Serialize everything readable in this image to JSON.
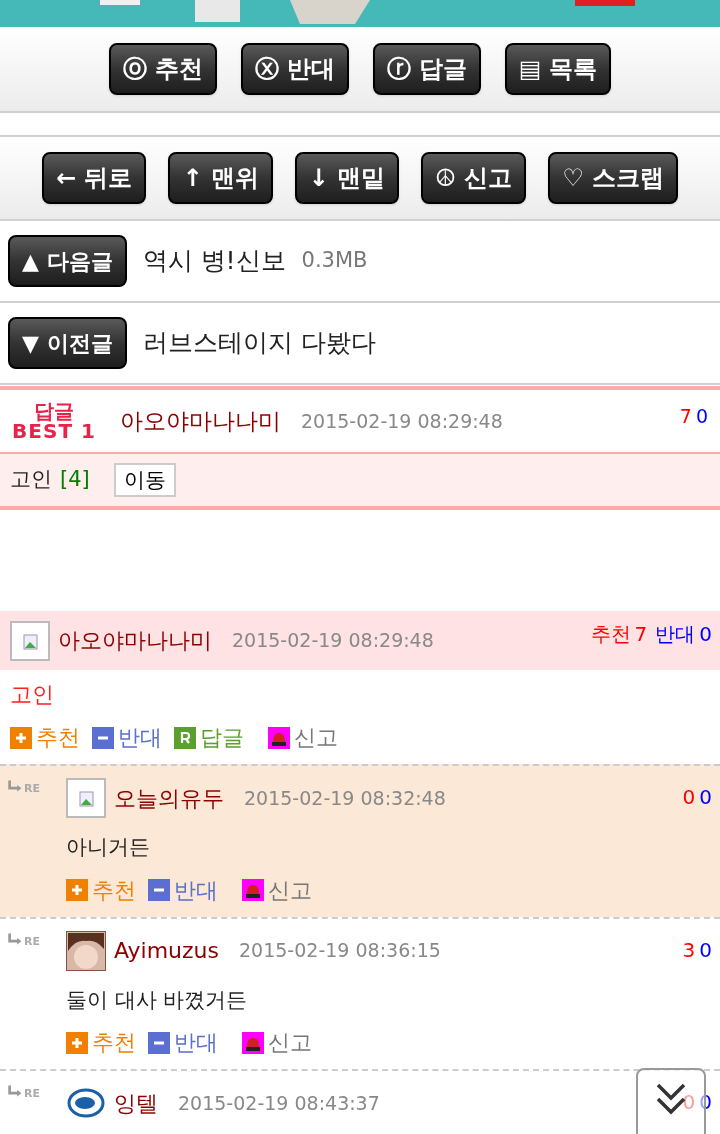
{
  "banner": {
    "kind": "picture"
  },
  "toolbar_top": [
    {
      "icon": "ⓞ",
      "label": "추천"
    },
    {
      "icon": "ⓧ",
      "label": "반대"
    },
    {
      "icon": "ⓡ",
      "label": "답글"
    },
    {
      "icon": "▤",
      "label": "목록"
    }
  ],
  "toolbar_nav": [
    {
      "icon": "←",
      "label": "뒤로"
    },
    {
      "icon": "↑",
      "label": "맨위"
    },
    {
      "icon": "↓",
      "label": "맨밑"
    },
    {
      "icon": "☮",
      "label": "신고"
    },
    {
      "icon": "♡",
      "label": "스크랩"
    }
  ],
  "adjacent_posts": [
    {
      "button": "▲ 다음글",
      "title": "역시 병!신보",
      "size": "0.3MB"
    },
    {
      "button": "▼ 이전글",
      "title": "러브스테이지 다봤다"
    }
  ],
  "best_reply": {
    "badge_top": "답글",
    "badge_bottom": "BEST 1",
    "author": "아오야마나나미",
    "date": "2015-02-19 08:29:48",
    "up": "7",
    "down": "0",
    "body": "고인",
    "count": "[4]",
    "move_button": "이동"
  },
  "comments": [
    {
      "kind": "comment",
      "avatar": {
        "kind": "broken"
      },
      "author": "아오야마나나미",
      "date": "2015-02-19 08:29:48",
      "up_label": "추천",
      "up": "7",
      "down_label": "반대",
      "down": "0",
      "body": "고인",
      "actions": [
        {
          "kind": "up",
          "label": "추천"
        },
        {
          "kind": "down",
          "label": "반대"
        },
        {
          "kind": "reply",
          "label": "답글"
        },
        {
          "kind": "report",
          "label": "신고"
        }
      ]
    },
    {
      "kind": "reply",
      "re_label": "RE",
      "avatar": {
        "kind": "broken"
      },
      "highlighted": true,
      "author": "오늘의유두",
      "date": "2015-02-19 08:32:48",
      "up": "0",
      "down": "0",
      "body": "아니거든",
      "actions": [
        {
          "kind": "up",
          "label": "추천"
        },
        {
          "kind": "down",
          "label": "반대"
        },
        {
          "kind": "report",
          "label": "신고"
        }
      ]
    },
    {
      "kind": "reply",
      "re_label": "RE",
      "avatar": {
        "kind": "picture"
      },
      "highlighted": false,
      "author": "Ayimuzus",
      "date": "2015-02-19 08:36:15",
      "up": "3",
      "down": "0",
      "body": "둘이 대사 바꼈거든",
      "actions": [
        {
          "kind": "up",
          "label": "추천"
        },
        {
          "kind": "down",
          "label": "반대"
        },
        {
          "kind": "report",
          "label": "신고"
        }
      ]
    },
    {
      "kind": "reply",
      "re_label": "RE",
      "avatar": {
        "kind": "logo"
      },
      "highlighted": false,
      "author": "잉텔",
      "date": "2015-02-19 08:43:37",
      "up": "0",
      "down": "0"
    }
  ]
}
